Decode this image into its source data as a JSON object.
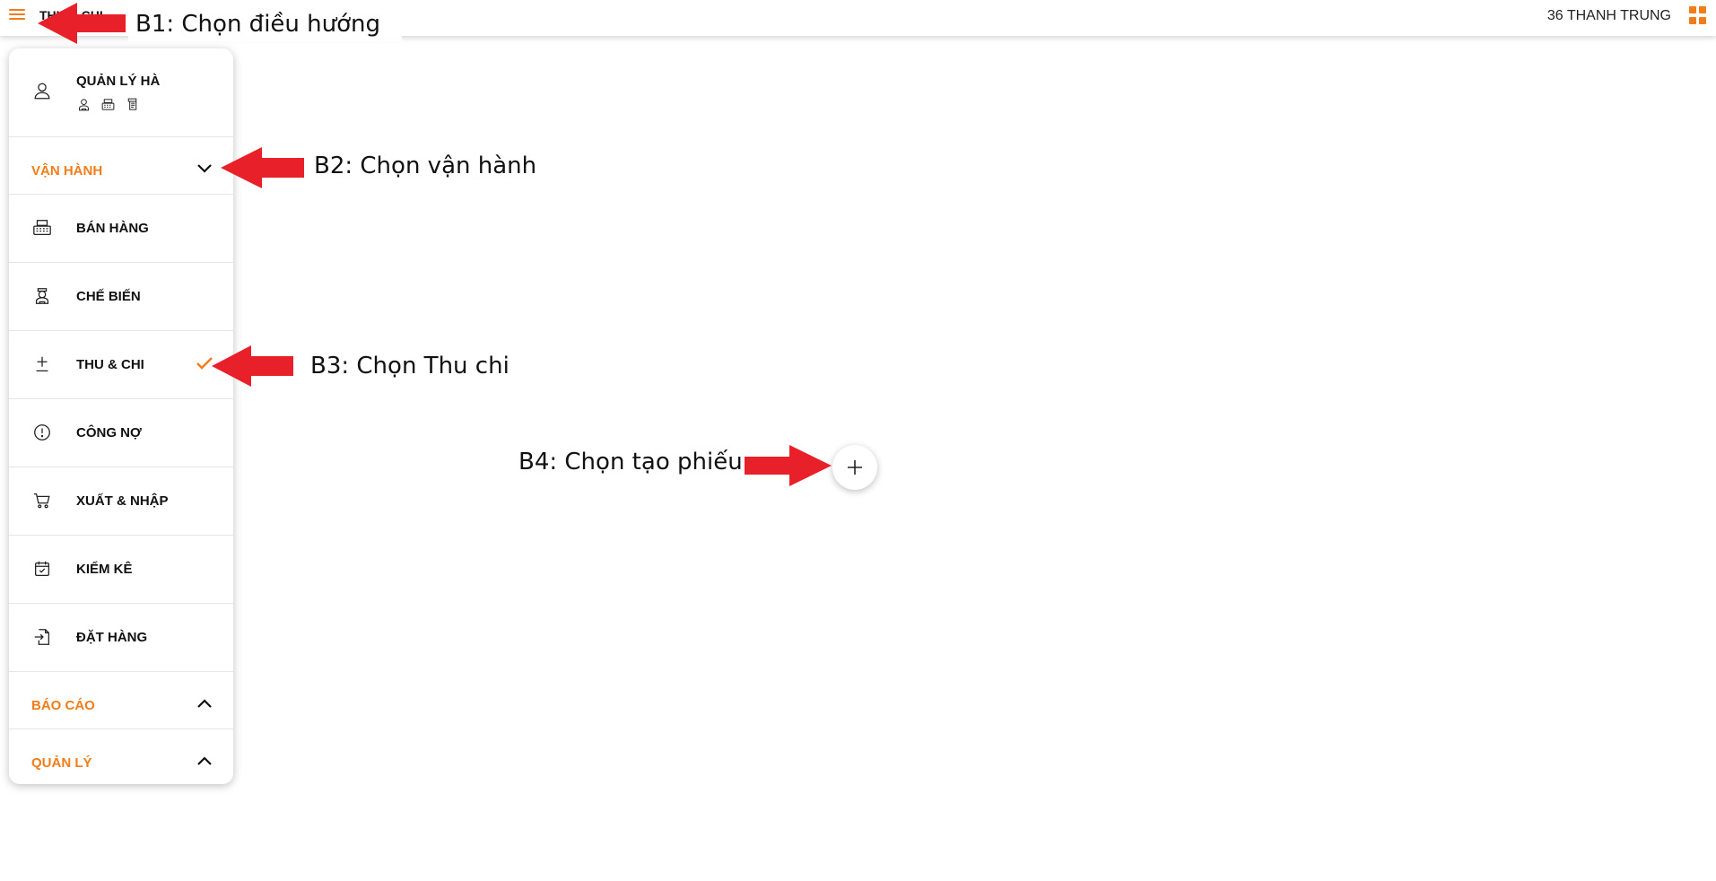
{
  "header": {
    "title": "THU & CHI",
    "user": "36 THANH TRUNG",
    "menu_icon": "hamburger-icon",
    "apps_icon": "grid-icon",
    "accent": "#f07c1a"
  },
  "drawer": {
    "profile": {
      "name": "QUẢN LÝ HÀ",
      "role_icons": [
        "chef-icon",
        "cash-register-icon",
        "scroll-icon"
      ]
    },
    "sections": [
      {
        "label": "VẬN HÀNH",
        "expanded": true,
        "items": [
          {
            "label": "BÁN HÀNG",
            "icon": "cash-register-icon",
            "active": false
          },
          {
            "label": "CHẾ BIẾN",
            "icon": "chef-icon",
            "active": false
          },
          {
            "label": "THU & CHI",
            "icon": "plus-minus-icon",
            "active": true
          },
          {
            "label": "CÔNG NỢ",
            "icon": "alert-circle-icon",
            "active": false
          },
          {
            "label": "XUẤT & NHẬP",
            "icon": "cart-icon",
            "active": false
          },
          {
            "label": "KIỂM KÊ",
            "icon": "calendar-check-icon",
            "active": false
          },
          {
            "label": "ĐẶT HÀNG",
            "icon": "import-icon",
            "active": false
          }
        ]
      },
      {
        "label": "BÁO CÁO",
        "expanded": false
      },
      {
        "label": "QUẢN LÝ",
        "expanded": false
      }
    ]
  },
  "fab": {
    "icon": "plus-icon"
  },
  "annotations": {
    "b1": "B1: Chọn điều hướng",
    "b2": "B2: Chọn vận hành",
    "b3": "B3: Chọn Thu chi",
    "b4": "B4: Chọn tạo phiếu",
    "arrow_color": "#e8202a"
  }
}
